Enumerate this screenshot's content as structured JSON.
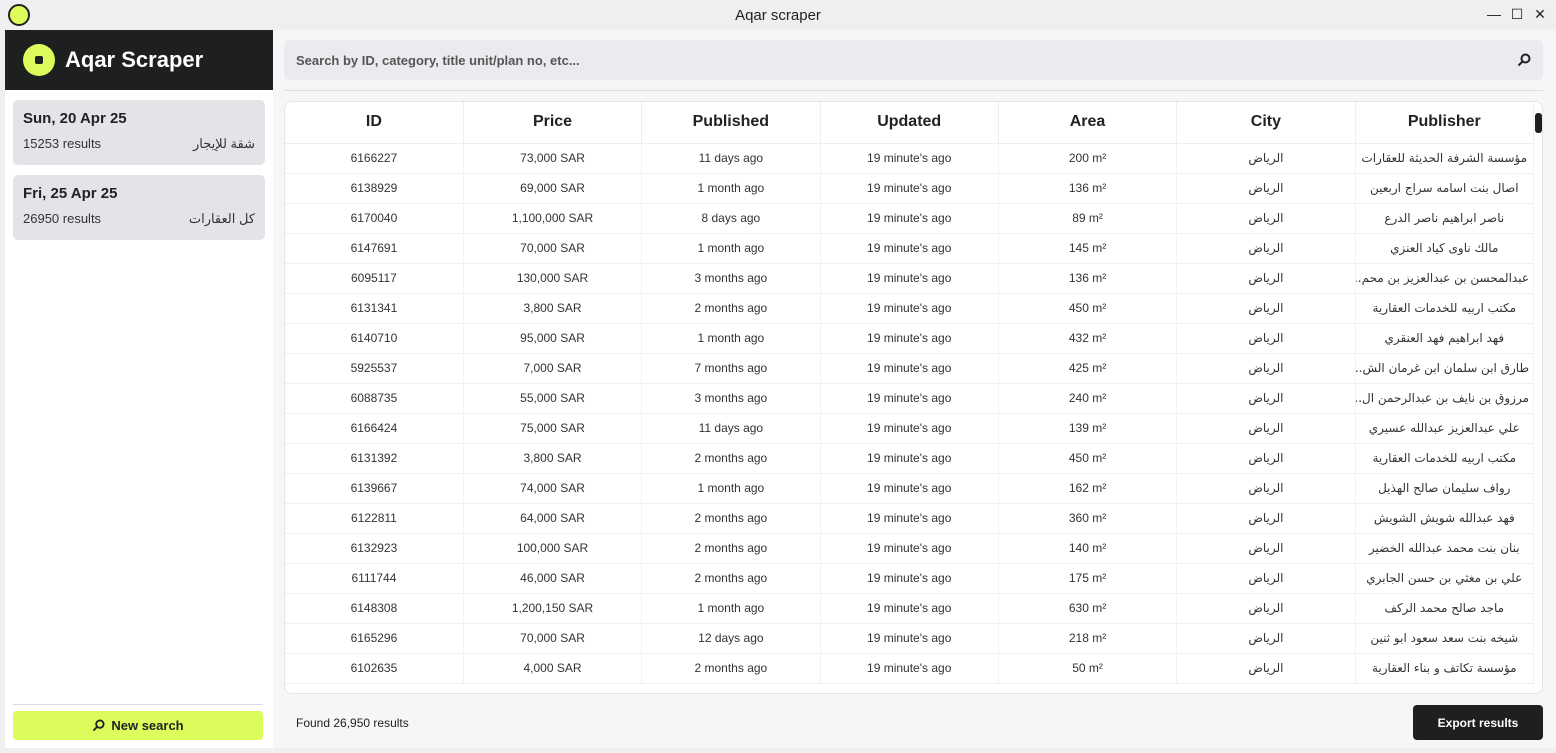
{
  "window": {
    "title": "Aqar scraper",
    "minimize": "—",
    "maximize": "☐",
    "close": "✕"
  },
  "sidebar": {
    "brand": "Aqar Scraper",
    "history": [
      {
        "date": "Sun, 20 Apr 25",
        "results": "15253 results",
        "category": "شقة للإيجار"
      },
      {
        "date": "Fri, 25 Apr 25",
        "results": "26950 results",
        "category": "كل العقارات"
      }
    ],
    "new_search": "New search"
  },
  "search": {
    "placeholder": "Search by ID, category, title unit/plan no, etc...",
    "value": ""
  },
  "table": {
    "columns": [
      "ID",
      "Price",
      "Published",
      "Updated",
      "Area",
      "City",
      "Publisher"
    ],
    "rows": [
      [
        "6166227",
        "73,000 SAR",
        "11 days ago",
        "19 minute's ago",
        "200 m²",
        "الرياض",
        "مؤسسة الشرفة الحديثة للعقارات"
      ],
      [
        "6138929",
        "69,000 SAR",
        "1 month ago",
        "19 minute's ago",
        "136 m²",
        "الرياض",
        "اصال بنت اسامه سراج اربعين"
      ],
      [
        "6170040",
        "1,100,000 SAR",
        "8 days ago",
        "19 minute's ago",
        "89 m²",
        "الرياض",
        "ناصر ابراهيم ناصر الدرع"
      ],
      [
        "6147691",
        "70,000 SAR",
        "1 month ago",
        "19 minute's ago",
        "145 m²",
        "الرياض",
        "مالك ناوى كياد العنزي"
      ],
      [
        "6095117",
        "130,000 SAR",
        "3 months ago",
        "19 minute's ago",
        "136 m²",
        "الرياض",
        "عبدالمحسن بن عبدالعزيز بن محم..."
      ],
      [
        "6131341",
        "3,800 SAR",
        "2 months ago",
        "19 minute's ago",
        "450 m²",
        "الرياض",
        "مكتب اربيه للخدمات العقارية"
      ],
      [
        "6140710",
        "95,000 SAR",
        "1 month ago",
        "19 minute's ago",
        "432 m²",
        "الرياض",
        "فهد ابراهيم فهد العنقري"
      ],
      [
        "5925537",
        "7,000 SAR",
        "7 months ago",
        "19 minute's ago",
        "425 m²",
        "الرياض",
        "طارق ابن سلمان ابن غرمان الش..."
      ],
      [
        "6088735",
        "55,000 SAR",
        "3 months ago",
        "19 minute's ago",
        "240 m²",
        "الرياض",
        "مرزوق بن نايف بن عبدالرحمن ال..."
      ],
      [
        "6166424",
        "75,000 SAR",
        "11 days ago",
        "19 minute's ago",
        "139 m²",
        "الرياض",
        "علي عبدالعزيز عبدالله عسيري"
      ],
      [
        "6131392",
        "3,800 SAR",
        "2 months ago",
        "19 minute's ago",
        "450 m²",
        "الرياض",
        "مكتب اربيه للخدمات العقارية"
      ],
      [
        "6139667",
        "74,000 SAR",
        "1 month ago",
        "19 minute's ago",
        "162 m²",
        "الرياض",
        "رواف سليمان صالح الهذيل"
      ],
      [
        "6122811",
        "64,000 SAR",
        "2 months ago",
        "19 minute's ago",
        "360 m²",
        "الرياض",
        "فهد عبدالله شويش الشويش"
      ],
      [
        "6132923",
        "100,000 SAR",
        "2 months ago",
        "19 minute's ago",
        "140 m²",
        "الرياض",
        "بنان بنت محمد عبدالله الخضير"
      ],
      [
        "6111744",
        "46,000 SAR",
        "2 months ago",
        "19 minute's ago",
        "175 m²",
        "الرياض",
        "علي بن مغثي بن حسن الجابري"
      ],
      [
        "6148308",
        "1,200,150 SAR",
        "1 month ago",
        "19 minute's ago",
        "630 m²",
        "الرياض",
        "ماجد صالح محمد الركف"
      ],
      [
        "6165296",
        "70,000 SAR",
        "12 days ago",
        "19 minute's ago",
        "218 m²",
        "الرياض",
        "شيخه بنت سعد سعود ابو ثنين"
      ],
      [
        "6102635",
        "4,000 SAR",
        "2 months ago",
        "19 minute's ago",
        "50 m²",
        "الرياض",
        "مؤسسة تكاتف و بناء العقارية"
      ]
    ]
  },
  "footer": {
    "found": "Found 26,950 results",
    "export": "Export results"
  },
  "colors": {
    "accent": "#dcfc5c",
    "dark": "#1d201f"
  }
}
